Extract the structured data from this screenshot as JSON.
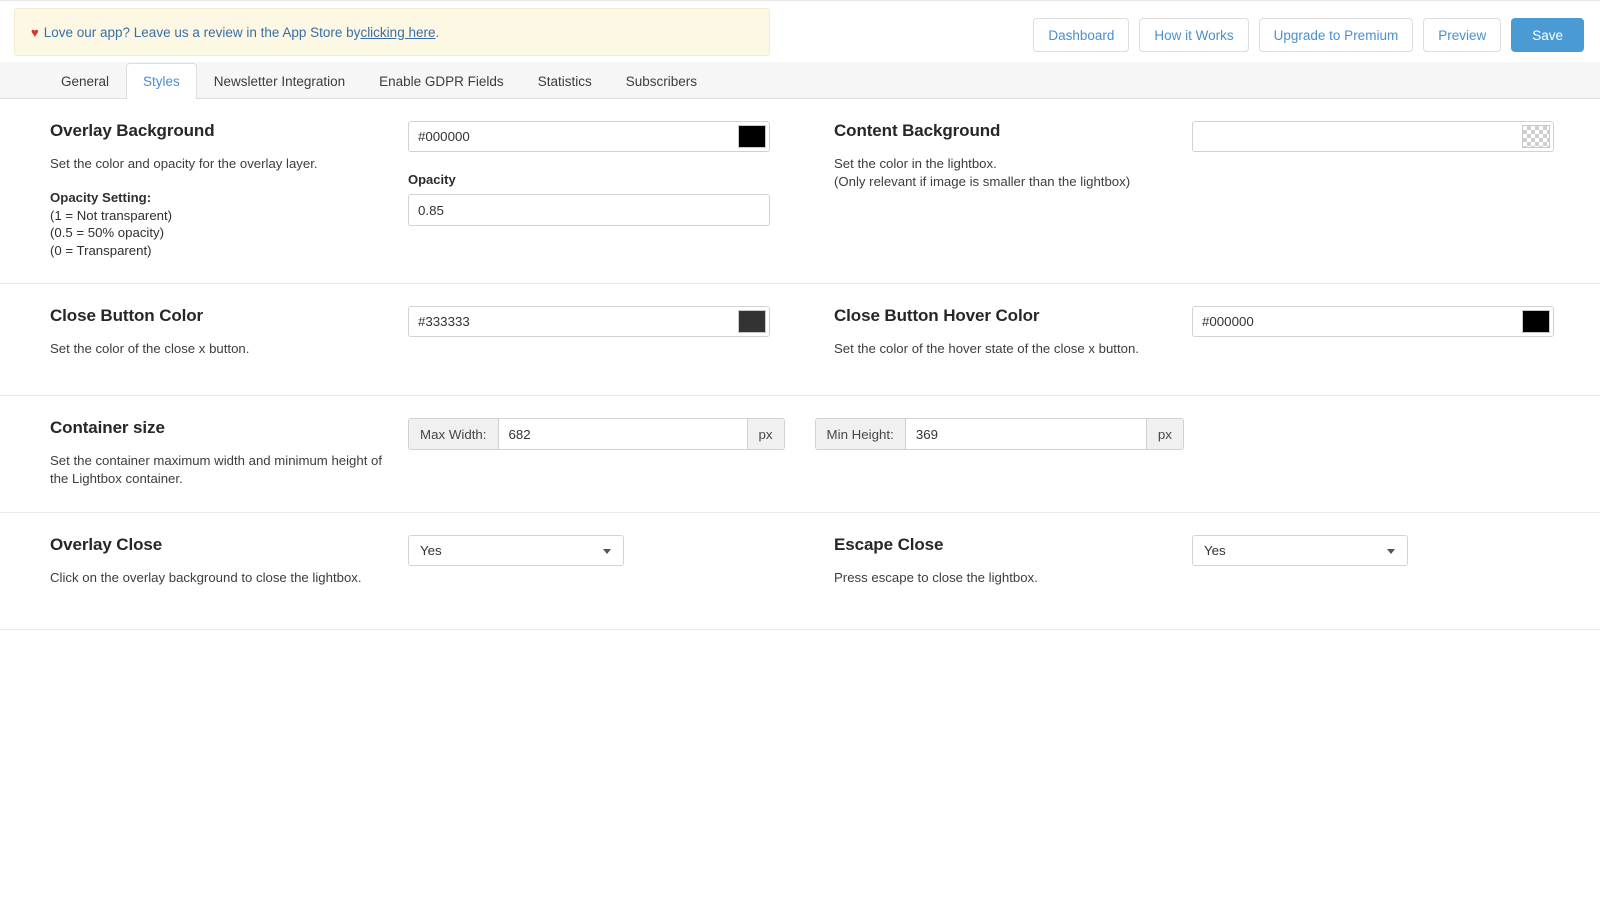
{
  "notice": {
    "icon": "heart-icon",
    "text_before": "Love our app? Leave us a review in the App Store by ",
    "link_text": "clicking here",
    "text_after": "."
  },
  "actions": {
    "dashboard": "Dashboard",
    "how_it_works": "How it Works",
    "upgrade": "Upgrade to Premium",
    "preview": "Preview",
    "save": "Save",
    "primary_color": "#4a9ad4"
  },
  "tabs": [
    {
      "label": "General",
      "active": false
    },
    {
      "label": "Styles",
      "active": true
    },
    {
      "label": "Newsletter Integration",
      "active": false
    },
    {
      "label": "Enable GDPR Fields",
      "active": false
    },
    {
      "label": "Statistics",
      "active": false
    },
    {
      "label": "Subscribers",
      "active": false
    }
  ],
  "sections": {
    "overlay_background": {
      "title": "Overlay Background",
      "desc": "Set the color and opacity for the overlay layer.",
      "opacity_help_title": "Opacity Setting:",
      "opacity_help_1": "(1 = Not transparent)",
      "opacity_help_2": "(0.5 = 50% opacity)",
      "opacity_help_3": "(0 = Transparent)",
      "color_value": "#000000",
      "swatch_color": "#000000",
      "opacity_label": "Opacity",
      "opacity_value": "0.85"
    },
    "content_background": {
      "title": "Content Background",
      "desc_line1": "Set the color in the lightbox.",
      "desc_line2": "(Only relevant if image is smaller than the lightbox)",
      "color_value": "",
      "swatch_kind": "transparent-checker"
    },
    "close_button_color": {
      "title": "Close Button Color",
      "desc": "Set the color of the close x button.",
      "color_value": "#333333",
      "swatch_color": "#333333"
    },
    "close_button_hover_color": {
      "title": "Close Button Hover Color",
      "desc": "Set the color of the hover state of the close x button.",
      "color_value": "#000000",
      "swatch_color": "#000000"
    },
    "container_size": {
      "title": "Container size",
      "desc_line1": "Set the container maximum width and minimum height of",
      "desc_line2": "the Lightbox container.",
      "max_width_label": "Max Width:",
      "max_width_value": "682",
      "max_width_unit": "px",
      "min_height_label": "Min Height:",
      "min_height_value": "369",
      "min_height_unit": "px"
    },
    "overlay_close": {
      "title": "Overlay Close",
      "desc": "Click on the overlay background to close the lightbox.",
      "selected": "Yes"
    },
    "escape_close": {
      "title": "Escape Close",
      "desc": "Press escape to close the lightbox.",
      "selected": "Yes"
    }
  }
}
